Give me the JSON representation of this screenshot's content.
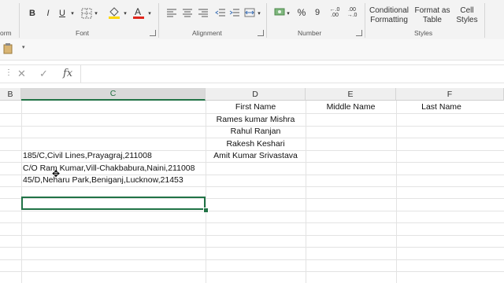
{
  "ribbon": {
    "groups": {
      "clipboard_tail": "orm",
      "font": "Font",
      "alignment": "Alignment",
      "number": "Number",
      "styles": "Styles"
    },
    "font_buttons": {
      "bold": "B",
      "italic": "I",
      "underline": "U"
    },
    "number_buttons": {
      "currency": "$",
      "percent": "%",
      "comma": "9",
      "inc_decimal": "←.0\n.00",
      "dec_decimal": ".00\n→.0"
    },
    "styles_buttons": {
      "conditional_formatting": "Conditional Formatting",
      "format_as_table": "Format as Table",
      "cell_styles": "Cell Styles"
    }
  },
  "formula_bar": {
    "cancel": "✕",
    "enter": "✓",
    "fx": "fx",
    "value": ""
  },
  "columns": [
    {
      "letter": "B"
    },
    {
      "letter": "C",
      "selected": true
    },
    {
      "letter": "D"
    },
    {
      "letter": "E"
    },
    {
      "letter": "F"
    }
  ],
  "cells": {
    "d_header": "First Name",
    "e_header": "Middle Name",
    "f_header": "Last Name",
    "names": [
      "Rames kumar Mishra",
      "Rahul Ranjan",
      "Rakesh Keshari",
      "Amit Kumar Srivastava"
    ],
    "addresses": [
      "185/C,Civil Lines,Prayagraj,211008",
      "C/O Ram Kumar,Vill-Chakbabura,Naini,211008",
      "45/D,Neharu Park,Beniganj,Lucknow,21453"
    ]
  },
  "colors": {
    "accent": "#217346",
    "highlight_yellow": "#ffd700",
    "font_red": "#e0261c"
  }
}
